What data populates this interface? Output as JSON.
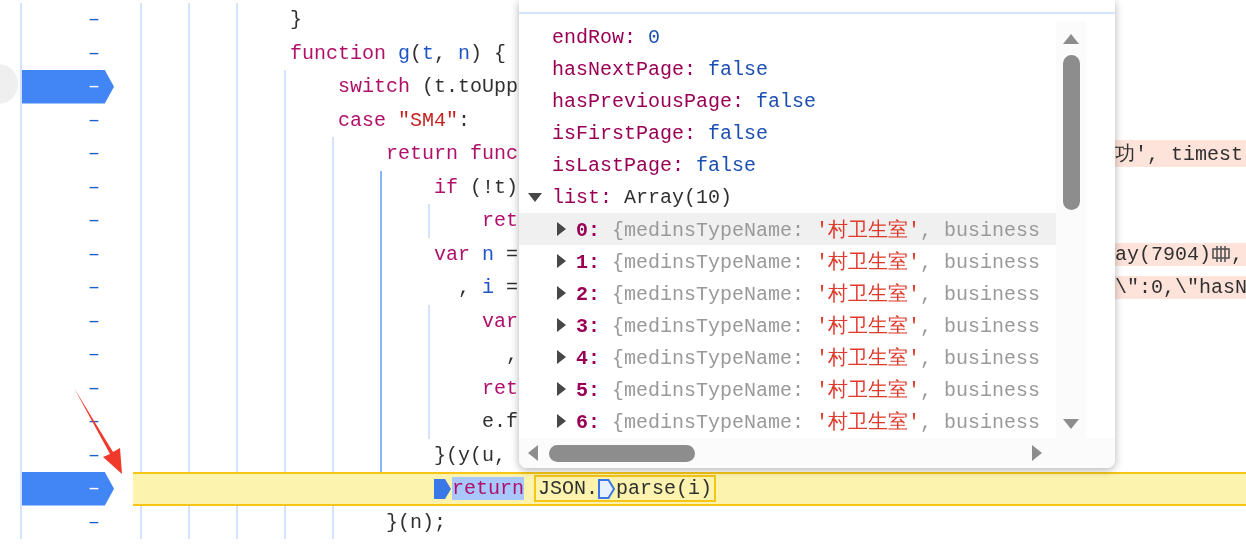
{
  "editor": {
    "lines": [
      {
        "kind": "statement",
        "number": "–",
        "breakpoint": false,
        "current": false,
        "tokens": [
          {
            "kind": "plain",
            "text": "}"
          }
        ]
      },
      {
        "kind": "statement",
        "number": "–",
        "breakpoint": false,
        "current": false,
        "tokens": [
          {
            "kind": "keyword",
            "text": "function "
          },
          {
            "kind": "ident",
            "text": "g"
          },
          {
            "kind": "plain",
            "text": "("
          },
          {
            "kind": "ident",
            "text": "t"
          },
          {
            "kind": "plain",
            "text": ", "
          },
          {
            "kind": "ident",
            "text": "n"
          },
          {
            "kind": "plain",
            "text": ") {"
          }
        ],
        "children": [
          {
            "kind": "statement",
            "number": "–",
            "breakpoint": true,
            "current": false,
            "tokens": [
              {
                "kind": "keyword",
                "text": "switch"
              },
              {
                "kind": "plain",
                "text": " (t.toUpp"
              }
            ]
          },
          {
            "kind": "statement",
            "number": "–",
            "breakpoint": false,
            "current": false,
            "tokens": [
              {
                "kind": "keyword",
                "text": "case "
              },
              {
                "kind": "string",
                "text": "\"SM4\""
              },
              {
                "kind": "plain",
                "text": ":"
              }
            ],
            "children": [
              {
                "kind": "statement",
                "number": "–",
                "breakpoint": false,
                "current": false,
                "tokens": [
                  {
                    "kind": "keyword",
                    "text": "return func"
                  }
                ],
                "tail": [
                  {
                    "kind": "plain",
                    "text": "功', timest"
                  }
                ],
                "children": [
                  {
                    "kind": "statement",
                    "number": "–",
                    "breakpoint": false,
                    "current": false,
                    "tokens": [
                      {
                        "kind": "keyword",
                        "text": "if"
                      },
                      {
                        "kind": "plain",
                        "text": " (!t)"
                      }
                    ],
                    "children": [
                      {
                        "kind": "statement",
                        "number": "–",
                        "breakpoint": false,
                        "current": false,
                        "tokens": [
                          {
                            "kind": "keyword",
                            "text": "ret"
                          }
                        ]
                      }
                    ]
                  },
                  {
                    "kind": "statement",
                    "number": "–",
                    "breakpoint": false,
                    "current": false,
                    "tokens": [
                      {
                        "kind": "keyword",
                        "text": "var "
                      },
                      {
                        "kind": "ident",
                        "text": "n"
                      },
                      {
                        "kind": "plain",
                        "text": " ="
                      }
                    ],
                    "tail": [
                      {
                        "kind": "plain",
                        "text": "ay(7904)"
                      },
                      {
                        "kind": "memory-icon"
                      },
                      {
                        "kind": "plain",
                        "text": ","
                      }
                    ],
                    "children": [
                      {
                        "kind": "continuation",
                        "number": "–",
                        "breakpoint": false,
                        "current": false,
                        "tokens": [
                          {
                            "kind": "plain",
                            "text": ", "
                          },
                          {
                            "kind": "ident",
                            "text": "i"
                          },
                          {
                            "kind": "plain",
                            "text": " ="
                          }
                        ],
                        "tail": [
                          {
                            "kind": "plain",
                            "text": "\\\":0,\\\"hasN"
                          }
                        ]
                      },
                      {
                        "kind": "statement",
                        "number": "–",
                        "breakpoint": false,
                        "current": false,
                        "tokens": [
                          {
                            "kind": "keyword",
                            "text": "var"
                          }
                        ],
                        "children": [
                          {
                            "kind": "continuation",
                            "number": "–",
                            "breakpoint": false,
                            "current": false,
                            "tokens": [
                              {
                                "kind": "plain",
                                "text": ","
                              }
                            ]
                          }
                        ]
                      },
                      {
                        "kind": "statement",
                        "number": "–",
                        "breakpoint": false,
                        "current": false,
                        "tokens": [
                          {
                            "kind": "keyword",
                            "text": "ret"
                          }
                        ]
                      },
                      {
                        "kind": "statement",
                        "number": "–",
                        "breakpoint": false,
                        "current": false,
                        "tokens": [
                          {
                            "kind": "plain",
                            "text": "e.f"
                          }
                        ]
                      }
                    ]
                  },
                  {
                    "kind": "statement",
                    "number": "–",
                    "breakpoint": false,
                    "current": false,
                    "tokens": [
                      {
                        "kind": "plain",
                        "text": "}(y(u,"
                      }
                    ]
                  },
                  {
                    "kind": "statement",
                    "number": "–",
                    "breakpoint": true,
                    "current": true,
                    "tokens": [
                      {
                        "kind": "exec-marker"
                      },
                      {
                        "kind": "keyword",
                        "text": "return",
                        "selected": true
                      },
                      {
                        "kind": "expression",
                        "children": [
                          {
                            "kind": "plain",
                            "text": "JSON.",
                            "selected": false
                          },
                          {
                            "kind": "step-marker"
                          },
                          {
                            "kind": "plain",
                            "text": "parse(i)",
                            "selected": false
                          }
                        ]
                      }
                    ]
                  }
                ]
              },
              {
                "kind": "statement",
                "number": "–",
                "breakpoint": false,
                "current": false,
                "tokens": [
                  {
                    "kind": "plain",
                    "text": "}(n);"
                  }
                ]
              }
            ]
          }
        ]
      }
    ]
  },
  "popover": {
    "properties": [
      {
        "key": "endRow:",
        "value": "0"
      },
      {
        "key": "hasNextPage:",
        "value": "false"
      },
      {
        "key": "hasPreviousPage:",
        "value": "false"
      },
      {
        "key": "isFirstPage:",
        "value": "false"
      },
      {
        "key": "isLastPage:",
        "value": "false"
      }
    ],
    "list": {
      "key": "list:",
      "value": "Array(10)",
      "expanded": true,
      "items": [
        {
          "index": "0:",
          "preview": "{medinsTypeName: ",
          "value": "'村卫生室'",
          "rest": ", business",
          "expanded": false,
          "hovered": true
        },
        {
          "index": "1:",
          "preview": "{medinsTypeName: ",
          "value": "'村卫生室'",
          "rest": ", business",
          "expanded": false,
          "hovered": false
        },
        {
          "index": "2:",
          "preview": "{medinsTypeName: ",
          "value": "'村卫生室'",
          "rest": ", business",
          "expanded": false,
          "hovered": false
        },
        {
          "index": "3:",
          "preview": "{medinsTypeName: ",
          "value": "'村卫生室'",
          "rest": ", business",
          "expanded": false,
          "hovered": false
        },
        {
          "index": "4:",
          "preview": "{medinsTypeName: ",
          "value": "'村卫生室'",
          "rest": ", business",
          "expanded": false,
          "hovered": false
        },
        {
          "index": "5:",
          "preview": "{medinsTypeName: ",
          "value": "'村卫生室'",
          "rest": ", business",
          "expanded": false,
          "hovered": false
        },
        {
          "index": "6:",
          "preview": "{medinsTypeName: ",
          "value": "'村卫生室'",
          "rest": ", business",
          "expanded": false,
          "hovered": false
        }
      ]
    }
  }
}
